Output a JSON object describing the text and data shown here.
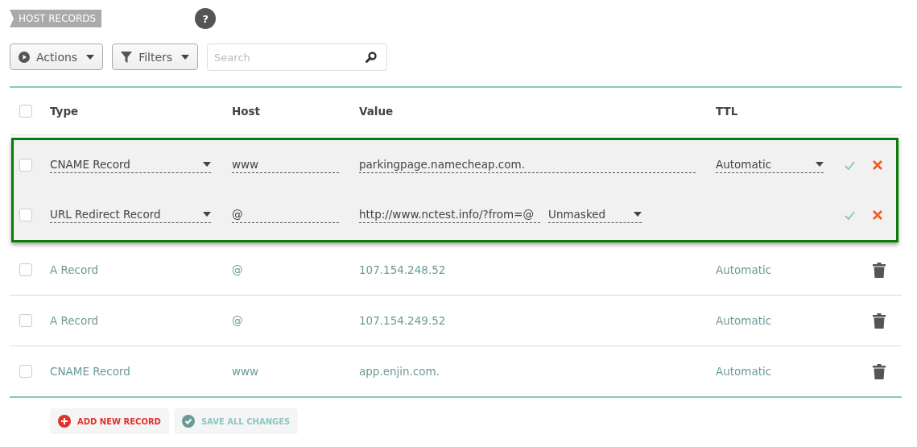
{
  "section_title": "HOST RECORDS",
  "help": "?",
  "toolbar": {
    "actions": "Actions",
    "filters": "Filters",
    "search": {
      "placeholder": "Search"
    }
  },
  "table": {
    "columns": [
      "Type",
      "Host",
      "Value",
      "TTL"
    ],
    "header_checked": false,
    "rows": [
      {
        "kind": "edit",
        "checked": false,
        "type": "CNAME Record",
        "host": "www",
        "value": "parkingpage.namecheap.com.",
        "ttl": "Automatic"
      },
      {
        "kind": "edit",
        "checked": false,
        "type": "URL Redirect Record",
        "host": "@",
        "value": "http://www.nctest.info/?from=@",
        "mode": "Unmasked"
      },
      {
        "kind": "view",
        "checked": false,
        "type": "A Record",
        "host": "@",
        "value": "107.154.248.52",
        "ttl": "Automatic"
      },
      {
        "kind": "view",
        "checked": false,
        "type": "A Record",
        "host": "@",
        "value": "107.154.249.52",
        "ttl": "Automatic"
      },
      {
        "kind": "view",
        "checked": false,
        "type": "CNAME Record",
        "host": "www",
        "value": "app.enjin.com.",
        "ttl": "Automatic"
      }
    ]
  },
  "footer": {
    "add": "ADD NEW RECORD",
    "save": "SAVE ALL CHANGES"
  }
}
